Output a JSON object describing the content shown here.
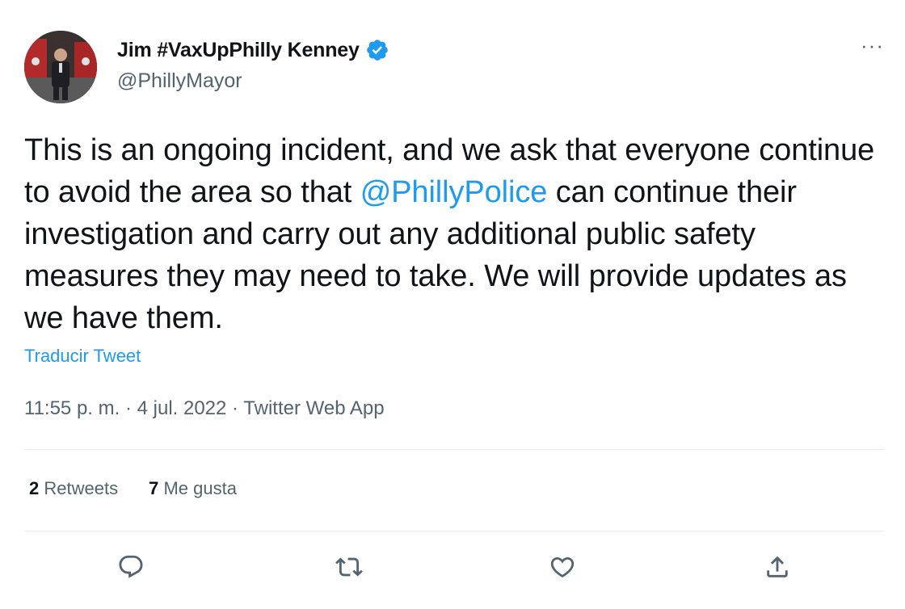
{
  "author": {
    "display_name": "Jim #VaxUpPhilly Kenney",
    "handle": "@PhillyMayor",
    "verified_icon": "verified-badge-icon",
    "avatar_icon": "profile-photo"
  },
  "more_icon": "more-options-icon",
  "more_label": "···",
  "tweet": {
    "text_before": "This is an ongoing incident, and we ask that everyone continue to avoid the area so that ",
    "mention": "@PhillyPolice",
    "text_after": " can continue their investigation and carry out any additional public safety measures they may need to take. We will provide updates as we have them."
  },
  "translate_label": "Traducir Tweet",
  "meta": {
    "time": "11:55 p. m.",
    "separator": " · ",
    "date": "4 jul. 2022",
    "source": "Twitter Web App"
  },
  "stats": {
    "retweets_count": "2",
    "retweets_label": "Retweets",
    "likes_count": "7",
    "likes_label": "Me gusta"
  },
  "actions": [
    {
      "icon": "reply-icon"
    },
    {
      "icon": "retweet-icon"
    },
    {
      "icon": "like-icon"
    },
    {
      "icon": "share-icon"
    }
  ],
  "colors": {
    "link": "#1d9bf0",
    "text": "#0f1419",
    "secondary": "#536471",
    "divider": "#e6ecf0"
  }
}
